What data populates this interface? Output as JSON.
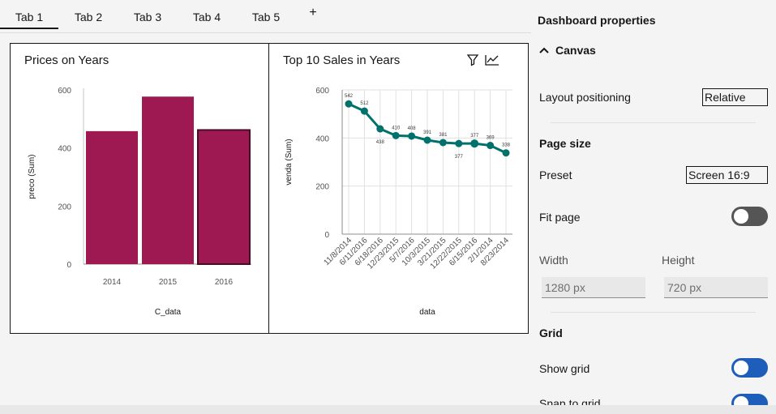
{
  "tabs": [
    {
      "label": "Tab 1",
      "active": true
    },
    {
      "label": "Tab 2",
      "active": false
    },
    {
      "label": "Tab 3",
      "active": false
    },
    {
      "label": "Tab 4",
      "active": false
    },
    {
      "label": "Tab 5",
      "active": false
    }
  ],
  "tab_add_label": "+",
  "widgets": {
    "prices": {
      "title": "Prices on Years"
    },
    "sales": {
      "title": "Top 10 Sales in Years",
      "filter_icon": "filter-icon",
      "chart_icon": "line-chart-icon"
    }
  },
  "chart_data": [
    {
      "type": "bar",
      "title": "Prices on Years",
      "xlabel": "C_data",
      "ylabel": "preco (Sum)",
      "categories": [
        "2014",
        "2015",
        "2016"
      ],
      "values": [
        458,
        577,
        462
      ],
      "ylim": [
        0,
        600
      ],
      "yticks": [
        "0",
        "200",
        "400",
        "600"
      ],
      "grid": false,
      "highlight_index": 2,
      "color": "#9e1951",
      "highlight_color": "#9e1951"
    },
    {
      "type": "line",
      "title": "Top 10 Sales in Years",
      "xlabel": "data",
      "ylabel": "venda (Sum)",
      "categories": [
        "11/8/2014",
        "6/11/2016",
        "6/18/2016",
        "12/23/2015",
        "5/7/2016",
        "10/3/2015",
        "3/21/2015",
        "12/22/2015",
        "6/15/2016",
        "2/1/2014",
        "8/23/2014"
      ],
      "values": [
        542,
        512,
        438,
        410,
        408,
        391,
        381,
        377,
        377,
        369,
        338
      ],
      "data_labels": [
        "542",
        "512",
        "438",
        "410",
        "408",
        "391",
        "381",
        "377",
        "377",
        "369",
        "338"
      ],
      "ylim": [
        0,
        600
      ],
      "yticks": [
        "0",
        "200",
        "400",
        "600"
      ],
      "grid": true,
      "color": "#00716b"
    }
  ],
  "panel": {
    "title": "Dashboard properties",
    "canvas_label": "Canvas",
    "layout_label": "Layout positioning",
    "layout_value": "Relative",
    "page_size_label": "Page size",
    "preset_label": "Preset",
    "preset_value": "Screen 16:9",
    "fit_page_label": "Fit page",
    "fit_page_on": false,
    "width_label": "Width",
    "width_value": "1280 px",
    "height_label": "Height",
    "height_value": "720 px",
    "grid_label": "Grid",
    "show_grid_label": "Show grid",
    "show_grid_on": true,
    "snap_grid_label": "Snap to grid",
    "snap_grid_on": true,
    "accent_color": "#1f5dbb"
  }
}
